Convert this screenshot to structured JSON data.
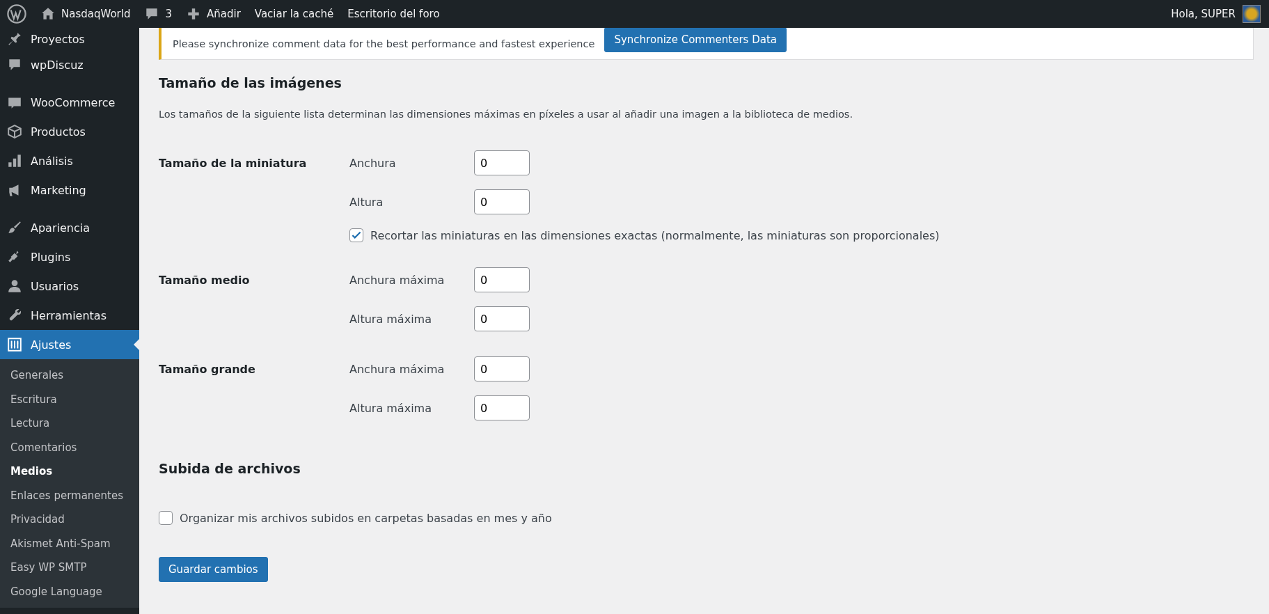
{
  "admin_bar": {
    "site": "NasdaqWorld",
    "comments": "3",
    "new": "Añadir",
    "links": [
      "Vaciar la caché",
      "Escritorio del foro"
    ],
    "greeting": "Hola, SUPER"
  },
  "sidebar": {
    "groups": [
      [
        {
          "label": "Proyectos",
          "selected": false
        },
        {
          "label": "wpDiscuz",
          "selected": false
        }
      ],
      [
        {
          "label": "WooCommerce",
          "selected": false
        },
        {
          "label": "Productos",
          "selected": false
        },
        {
          "label": "Análisis",
          "selected": false
        },
        {
          "label": "Marketing",
          "selected": false
        }
      ],
      [
        {
          "label": "Apariencia",
          "selected": false
        },
        {
          "label": "Plugins",
          "selected": false
        },
        {
          "label": "Usuarios",
          "selected": false
        },
        {
          "label": "Herramientas",
          "selected": false
        },
        {
          "label": "Ajustes",
          "selected": true
        }
      ]
    ],
    "submenu": [
      {
        "label": "Generales",
        "selected": false
      },
      {
        "label": "Escritura",
        "selected": false
      },
      {
        "label": "Lectura",
        "selected": false
      },
      {
        "label": "Comentarios",
        "selected": false
      },
      {
        "label": "Medios",
        "selected": true
      },
      {
        "label": "Enlaces permanentes",
        "selected": false
      },
      {
        "label": "Privacidad",
        "selected": false
      },
      {
        "label": "Akismet Anti-Spam",
        "selected": false
      },
      {
        "label": "Easy WP SMTP",
        "selected": false
      },
      {
        "label": "Google Language",
        "selected": false
      }
    ]
  },
  "notice": {
    "text": "Please synchronize comment data for the best performance and fastest experience",
    "button": "Synchronize Commenters Data"
  },
  "image_sizes": {
    "title": "Tamaño de las imágenes",
    "description": "Los tamaños de la siguiente lista determinan las dimensiones máximas en píxeles a usar al añadir una imagen a la biblioteca de medios.",
    "groups": [
      {
        "label": "Tamaño de la miniatura",
        "fields": [
          {
            "kind": "number",
            "label": "Anchura",
            "value": "0"
          },
          {
            "kind": "number",
            "label": "Altura",
            "value": "0"
          },
          {
            "kind": "checkbox",
            "label": "Recortar las miniaturas en las dimensiones exactas (normalmente, las miniaturas son proporcionales)",
            "checked": true
          }
        ]
      },
      {
        "label": "Tamaño medio",
        "fields": [
          {
            "kind": "number",
            "label": "Anchura máxima",
            "value": "0"
          },
          {
            "kind": "number",
            "label": "Altura máxima",
            "value": "0"
          }
        ]
      },
      {
        "label": "Tamaño grande",
        "fields": [
          {
            "kind": "number",
            "label": "Anchura máxima",
            "value": "0"
          },
          {
            "kind": "number",
            "label": "Altura máxima",
            "value": "0"
          }
        ]
      }
    ]
  },
  "uploads": {
    "title": "Subida de archivos",
    "option": {
      "label": "Organizar mis archivos subidos en carpetas basadas en mes y año",
      "checked": false
    }
  },
  "save_button": "Guardar cambios"
}
